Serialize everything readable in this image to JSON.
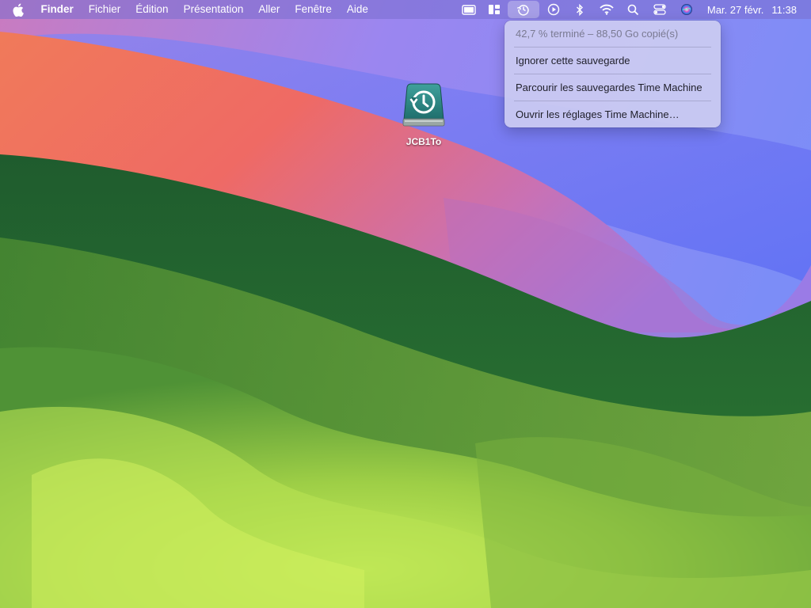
{
  "menubar": {
    "apple_icon": "apple-logo-icon",
    "app_name": "Finder",
    "menus": [
      "Fichier",
      "Édition",
      "Présentation",
      "Aller",
      "Fenêtre",
      "Aide"
    ],
    "status_icons": [
      "display-icon",
      "stage-manager-icon",
      "time-machine-icon",
      "play-icon",
      "bluetooth-icon",
      "wifi-icon",
      "search-icon",
      "control-center-icon",
      "siri-icon"
    ],
    "date": "Mar. 27 févr.",
    "time": "11:38"
  },
  "time_machine_menu": {
    "progress_text": "42,7 % terminé – 88,50 Go copié(s)",
    "progress_percent": 42.7,
    "items": [
      "Ignorer cette sauvegarde",
      "Parcourir les sauvegardes Time Machine",
      "Ouvrir les réglages Time Machine…"
    ]
  },
  "desktop": {
    "drive_label": "JCB1To",
    "drive_icon": "time-machine-drive-icon"
  },
  "colors": {
    "menubar": "#786ecd",
    "menu_bg": "#cdcdf2",
    "drive_teal": "#2f8a87"
  }
}
